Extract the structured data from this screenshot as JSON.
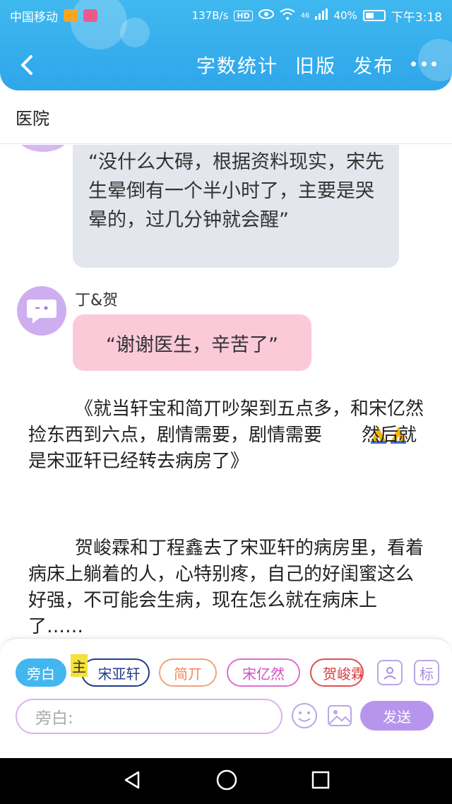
{
  "status_bar": {
    "carrier": "中国移动",
    "speed": "137B/s",
    "hd": "HD",
    "signal_label": "46",
    "battery": "40%",
    "time": "下午3:18"
  },
  "header": {
    "word_count": "字数统计",
    "old_version": "旧版",
    "publish": "发布"
  },
  "chapter_title": "医院",
  "messages": {
    "gray_bubble": "“没什么大碍，根据资料现实，宋先生晕倒有一个半小时了，主要是哭晕的，过几分钟就会醒”",
    "speaker": "丁&贺",
    "pink_bubble": "“谢谢医生，辛苦了”"
  },
  "narration": {
    "para1_a": "《就当轩宝和简丌吵架到五点多，和宋亿然捡东西到六点，剧情需要，剧情需要",
    "para1_b": "然后就是宋亚轩已经转去病房了》",
    "para2": "贺峻霖和丁程鑫去了宋亚轩的病房里，看着病床上躺着的人，心特别疼，自己的好闺蜜这么好强，不可能会生病，现在怎么就在病床上了……"
  },
  "composer": {
    "chip_narrator": "旁白",
    "main_tag": "主",
    "chip_song_yaxuan": "宋亚轩",
    "chip_jian": "简丌",
    "chip_song_yiran": "宋亿然",
    "chip_he": "贺峻霖",
    "tag_icon_label": "标",
    "input_placeholder": "旁白:",
    "send": "发送"
  },
  "colors": {
    "header_blue": "#2fa6ea",
    "gray_bubble": "#e4e6ed",
    "pink_bubble": "#fbcad9",
    "send_purple": "#b795ec"
  }
}
